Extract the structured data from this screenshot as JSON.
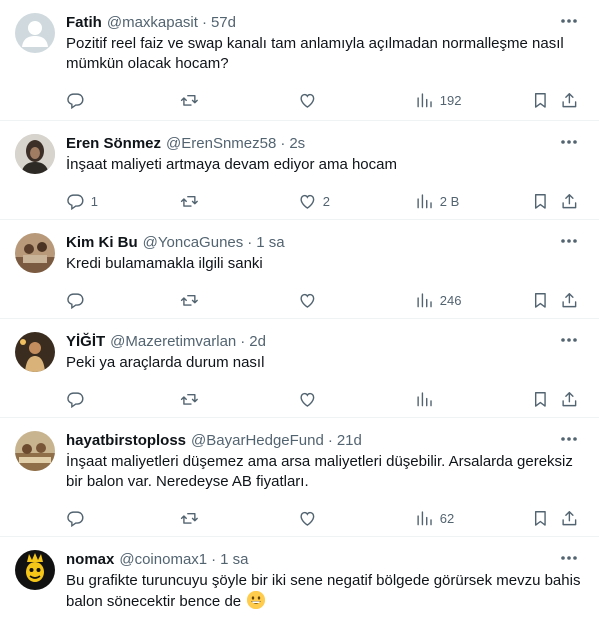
{
  "replies": [
    {
      "name": "Fatih",
      "handle": "@maxkapasit",
      "time": "57d",
      "text": "Pozitif reel faiz ve swap kanalı tam anlamıyla açılmadan normalleşme nasıl mümkün olacak hocam?",
      "avatar": "default-avatar",
      "replies": "",
      "reposts": "",
      "likes": "",
      "views": "192"
    },
    {
      "name": "Eren Sönmez",
      "handle": "@ErenSnmez58",
      "time": "2s",
      "text": "İnşaat maliyeti artmaya devam ediyor ama hocam",
      "avatar": "photo-avatar",
      "replies": "1",
      "reposts": "",
      "likes": "2",
      "views": "2 B"
    },
    {
      "name": "Kim Ki Bu",
      "handle": "@YoncaGunes",
      "time": "1 sa",
      "text": "Kredi bulamamakla ilgili sanki",
      "avatar": "photo-avatar",
      "replies": "",
      "reposts": "",
      "likes": "",
      "views": "246"
    },
    {
      "name": "YİĞİT",
      "handle": "@Mazeretimvarlan",
      "time": "2d",
      "text": "Peki ya araçlarda durum nasıl",
      "avatar": "photo-avatar",
      "replies": "",
      "reposts": "",
      "likes": "",
      "views": ""
    },
    {
      "name": "hayatbirstoploss",
      "handle": "@BayarHedgeFund",
      "time": "21d",
      "text": "İnşaat maliyetleri düşemez ama arsa maliyetleri düşebilir. Arsalarda gereksiz bir balon var. Neredeyse AB fiyatları.",
      "avatar": "photo-avatar",
      "replies": "",
      "reposts": "",
      "likes": "",
      "views": "62"
    },
    {
      "name": "nomax",
      "handle": "@coinomax1",
      "time": "1 sa",
      "text": "Bu grafikte turuncuyu şöyle bir iki sene negatif bölgede görürsek mevzu bahis balon sönecektir bence de",
      "avatar": "photo-avatar",
      "emoji": "grinning-face-emoji",
      "replies": "",
      "reposts": "",
      "likes": "",
      "views": ""
    }
  ],
  "colors": {
    "text": "#0f1419",
    "secondary": "#536471",
    "divider": "#eff3f4"
  }
}
